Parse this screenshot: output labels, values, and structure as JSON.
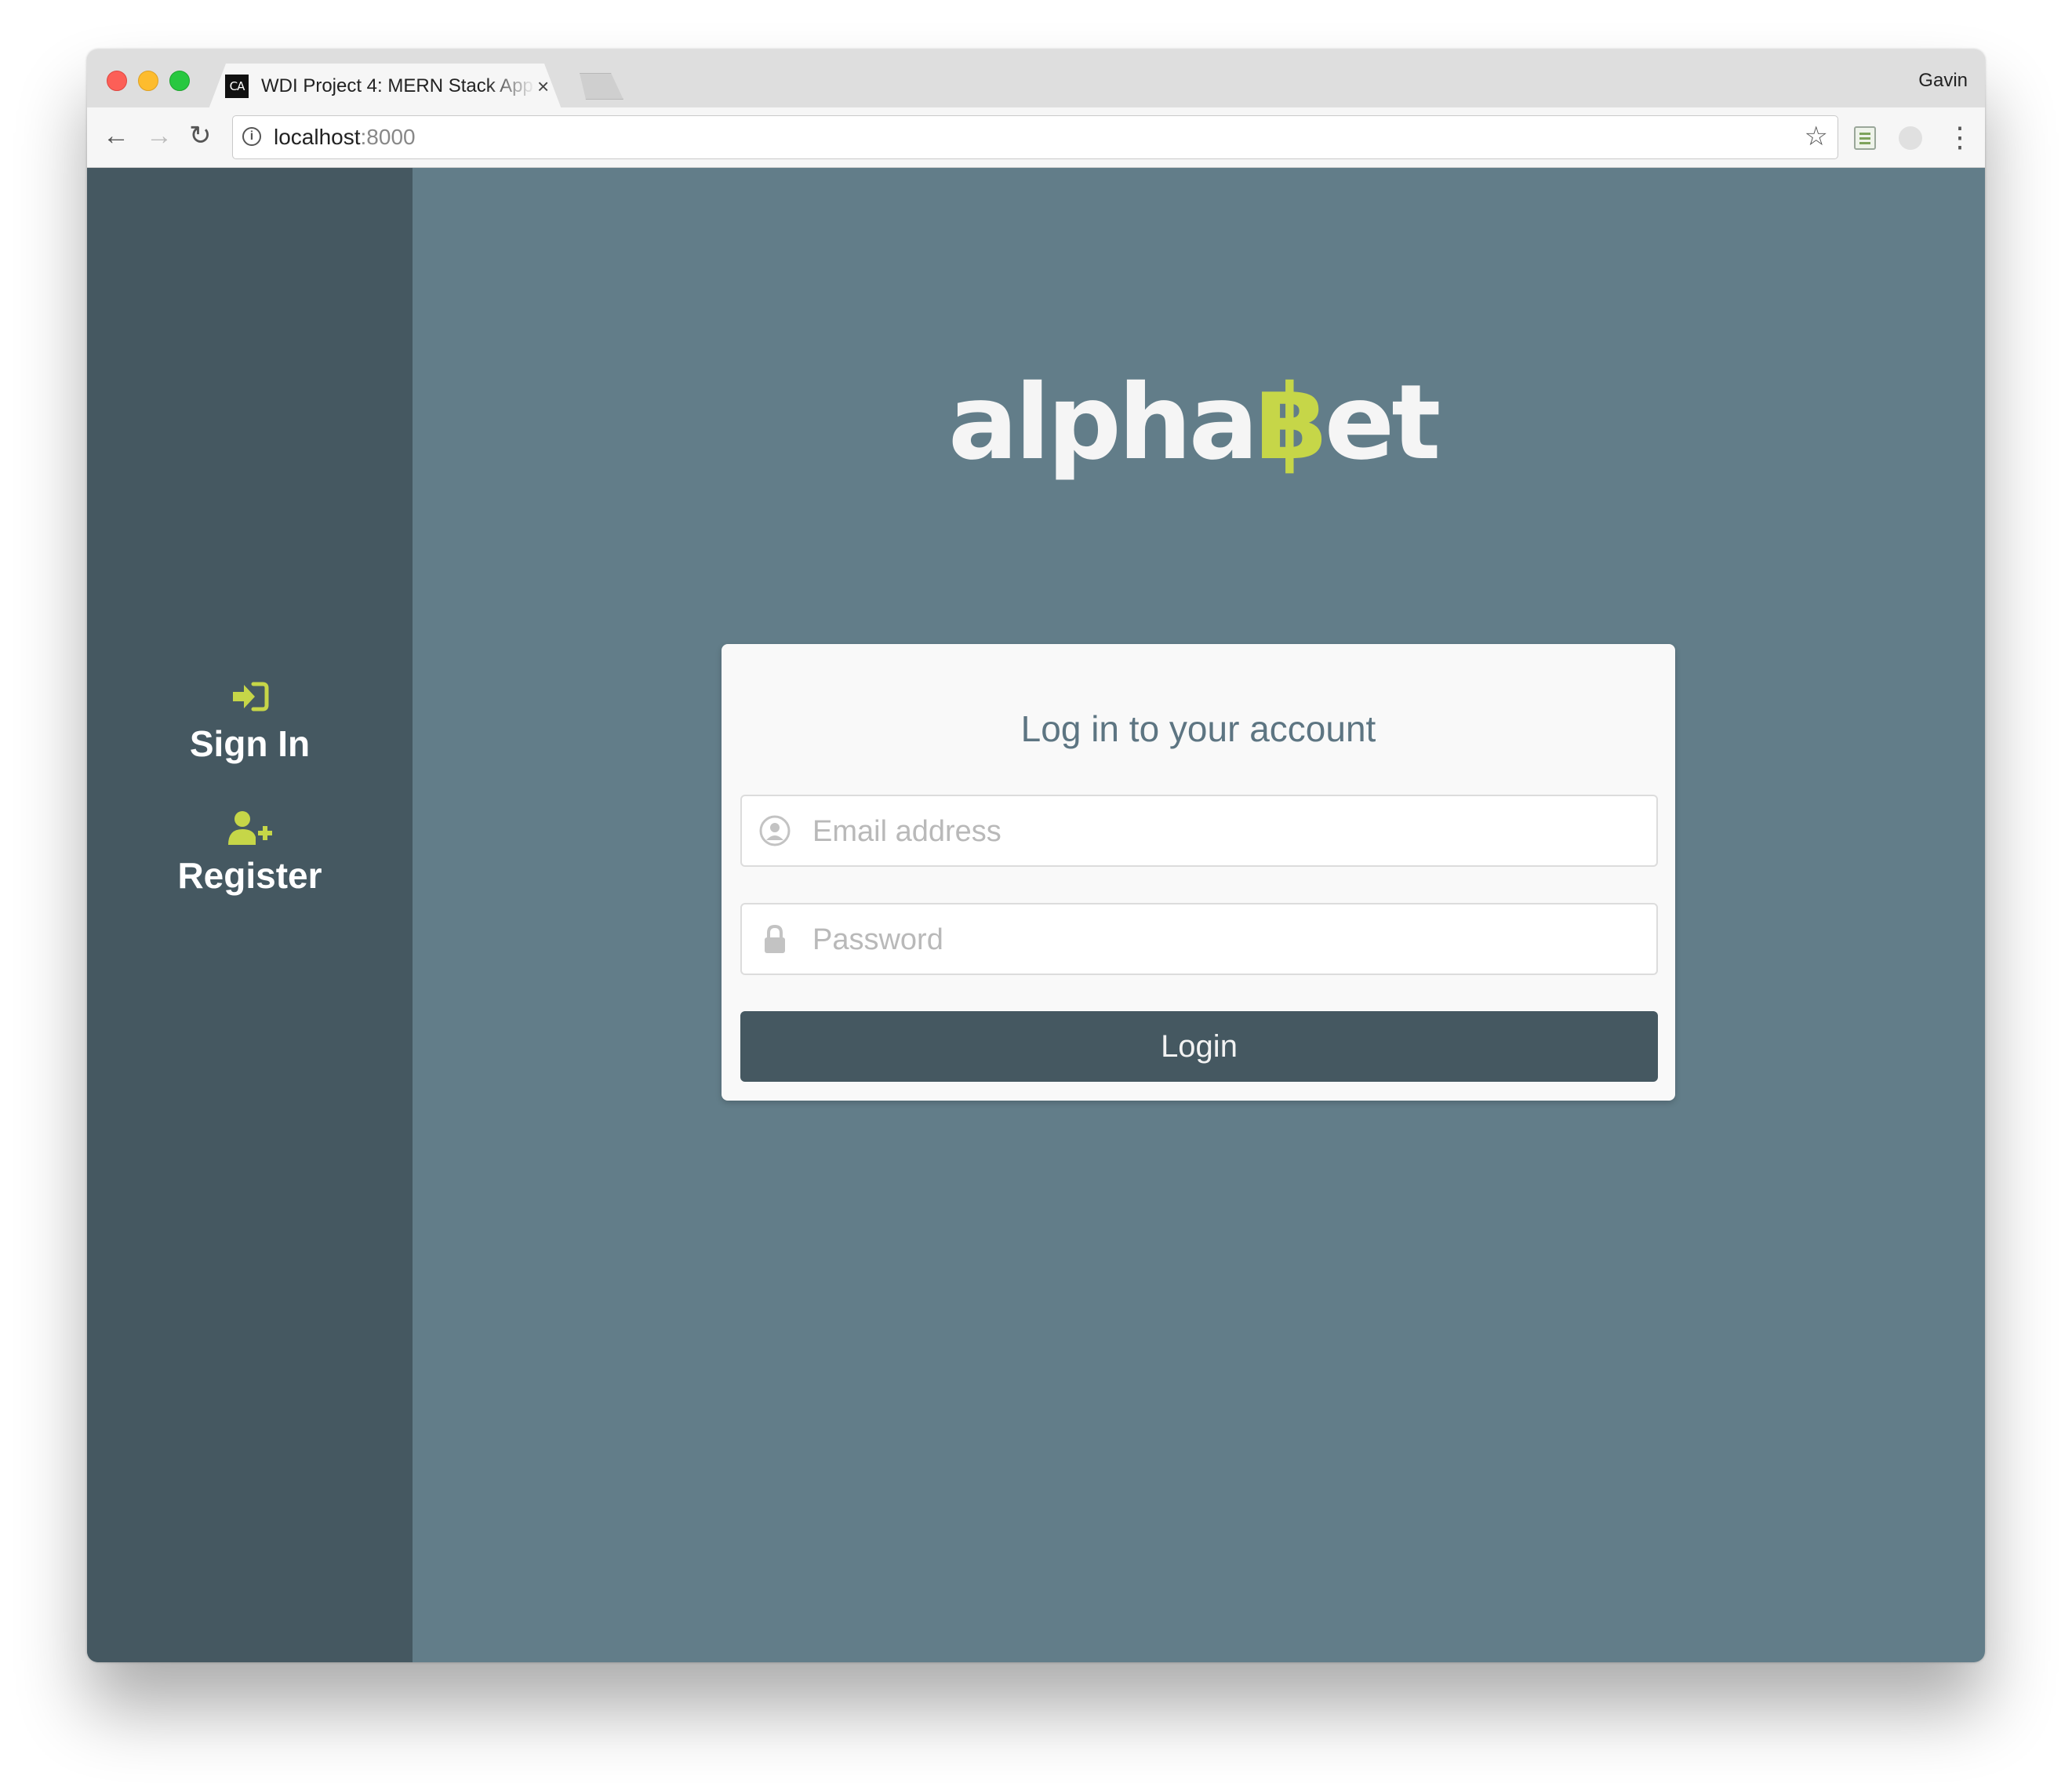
{
  "browser": {
    "tab_title": "WDI Project 4: MERN Stack App",
    "favicon_text": "CA",
    "tab_close_label": "×",
    "profile_name": "Gavin",
    "url_host": "localhost",
    "url_port": ":8000",
    "icons": [
      "back-arrow-icon",
      "forward-arrow-icon",
      "reload-icon",
      "info-icon",
      "star-icon",
      "sheets-extension-icon",
      "extension-icon",
      "menu-icon"
    ]
  },
  "sidebar": {
    "items": [
      {
        "label": "Sign In",
        "icon": "sign-in-icon"
      },
      {
        "label": "Register",
        "icon": "user-plus-icon"
      }
    ]
  },
  "logo": {
    "prefix": "alpha",
    "highlight": "฿",
    "suffix": "et"
  },
  "login_form": {
    "title": "Log in to your account",
    "email_placeholder": "Email address",
    "password_placeholder": "Password",
    "submit_label": "Login"
  },
  "colors": {
    "sidebar_bg": "#455861",
    "page_bg": "#627d89",
    "accent": "#c6d648",
    "button_bg": "#455861",
    "title_text": "#5d7582"
  }
}
